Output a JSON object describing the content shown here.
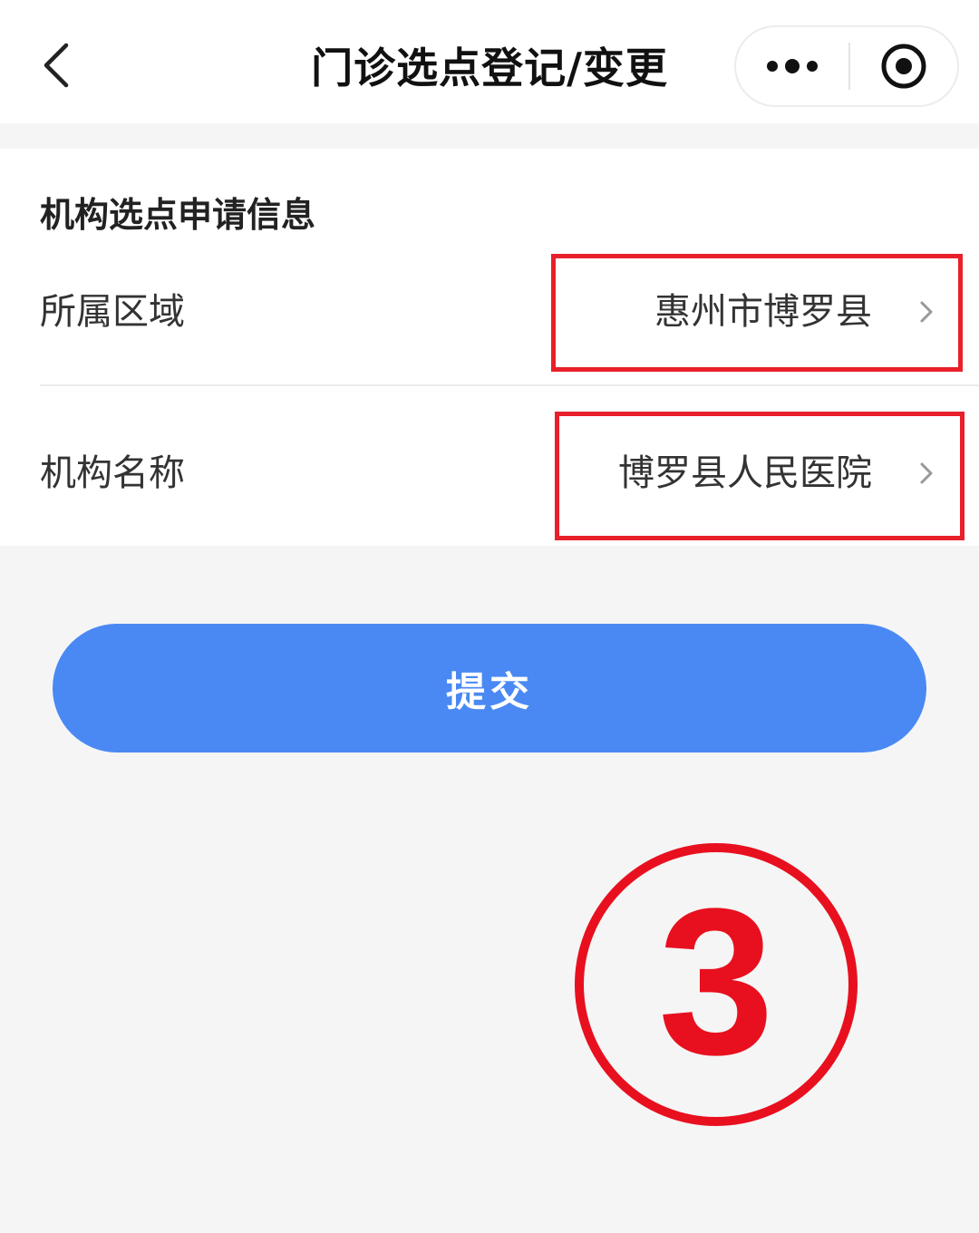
{
  "header": {
    "title": "门诊选点登记/变更"
  },
  "icons": {
    "back": "chevron-left-icon",
    "more": "more-dots-icon",
    "close": "target-circle-icon",
    "row_arrow": "chevron-right-icon"
  },
  "form": {
    "section_title": "机构选点申请信息",
    "region": {
      "label": "所属区域",
      "value": "惠州市博罗县"
    },
    "institution": {
      "label": "机构名称",
      "value": "博罗县人民医院"
    }
  },
  "submit": {
    "label": "提交"
  },
  "annotation": {
    "step": "3"
  },
  "colors": {
    "primary_button": "#4a89f3",
    "highlight_red": "#e8202a",
    "page_background": "#f5f5f5",
    "card_background": "#ffffff"
  }
}
